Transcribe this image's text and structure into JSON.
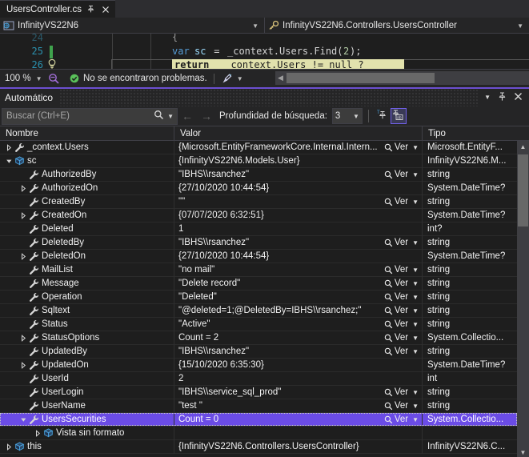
{
  "editor": {
    "tab": {
      "title": "UsersController.cs",
      "pin_icon": "pin-icon",
      "close_icon": "close-icon"
    },
    "navbar": {
      "project": "InfinityVS22N6",
      "member": "InfinityVS22N6.Controllers.UsersController"
    },
    "lines": [
      {
        "number": "24",
        "text": "{"
      },
      {
        "number": "25",
        "text": "var sc = _context.Users.Find(2);"
      },
      {
        "number": "26",
        "text": "return _context.Users != null ?"
      }
    ],
    "code": {
      "l25_kw": "var",
      "l25_var": "sc",
      "l25_eq": " = ",
      "l25_expr": "_context.Users.Find(",
      "l25_num": "2",
      "l25_end": ");",
      "l26_kw": "return",
      "l26_expr": " _context.Users != null ?"
    },
    "status": {
      "zoom": "100 %",
      "message": "No se encontraron problemas.",
      "zoom_caret_icon": "chevron-down-icon",
      "check_icon": "check-circle-icon",
      "broom_icon": "broom-icon",
      "broom_caret_icon": "chevron-down-icon"
    }
  },
  "autos": {
    "title": "Automático",
    "title_buttons": {
      "menu_icon": "chevron-down-icon",
      "pin_icon": "pin-icon",
      "close_icon": "close-icon"
    },
    "toolbar": {
      "search_placeholder": "Buscar (Ctrl+E)",
      "search_value": "",
      "search_icon": "search-icon",
      "search_caret_icon": "chevron-down-icon",
      "prev_icon": "arrow-left-icon",
      "next_icon": "arrow-right-icon",
      "depth_label": "Profundidad de búsqueda:",
      "depth_value": "3",
      "depth_caret_icon": "chevron-down-icon",
      "pin_tool_icon": "pin-variable-icon",
      "hex_tool_icon": "hex-display-icon"
    },
    "columns": [
      "Nombre",
      "Valor",
      "Tipo"
    ],
    "ver_label": "Ver",
    "ver_icon": "magnifier-icon",
    "ver_caret_icon": "chevron-down-icon",
    "rows": [
      {
        "indent": 0,
        "twisty": "collapsed",
        "icon": "wrench-icon",
        "name": "_context.Users",
        "value": "{Microsoft.EntityFrameworkCore.Internal.Intern...",
        "ver": true,
        "type": "Microsoft.EntityF...",
        "selected": false
      },
      {
        "indent": 0,
        "twisty": "expanded",
        "icon": "object-icon",
        "name": "sc",
        "value": "{InfinityVS22N6.Models.User}",
        "ver": false,
        "type": "InfinityVS22N6.M...",
        "selected": false
      },
      {
        "indent": 1,
        "twisty": "none",
        "icon": "wrench-icon",
        "name": "AuthorizedBy",
        "value": "\"IBHS\\\\rsanchez\"",
        "ver": true,
        "type": "string",
        "selected": false
      },
      {
        "indent": 1,
        "twisty": "collapsed",
        "icon": "wrench-icon",
        "name": "AuthorizedOn",
        "value": "{27/10/2020 10:44:54}",
        "ver": false,
        "type": "System.DateTime?",
        "selected": false
      },
      {
        "indent": 1,
        "twisty": "none",
        "icon": "wrench-icon",
        "name": "CreatedBy",
        "value": "\"\"",
        "ver": true,
        "type": "string",
        "selected": false
      },
      {
        "indent": 1,
        "twisty": "collapsed",
        "icon": "wrench-icon",
        "name": "CreatedOn",
        "value": "{07/07/2020 6:32:51}",
        "ver": false,
        "type": "System.DateTime?",
        "selected": false
      },
      {
        "indent": 1,
        "twisty": "none",
        "icon": "wrench-icon",
        "name": "Deleted",
        "value": "1",
        "ver": false,
        "type": "int?",
        "selected": false
      },
      {
        "indent": 1,
        "twisty": "none",
        "icon": "wrench-icon",
        "name": "DeletedBy",
        "value": "\"IBHS\\\\rsanchez\"",
        "ver": true,
        "type": "string",
        "selected": false
      },
      {
        "indent": 1,
        "twisty": "collapsed",
        "icon": "wrench-icon",
        "name": "DeletedOn",
        "value": "{27/10/2020 10:44:54}",
        "ver": false,
        "type": "System.DateTime?",
        "selected": false
      },
      {
        "indent": 1,
        "twisty": "none",
        "icon": "wrench-icon",
        "name": "MailList",
        "value": "\"no mail\"",
        "ver": true,
        "type": "string",
        "selected": false
      },
      {
        "indent": 1,
        "twisty": "none",
        "icon": "wrench-icon",
        "name": "Message",
        "value": "\"Delete record\"",
        "ver": true,
        "type": "string",
        "selected": false
      },
      {
        "indent": 1,
        "twisty": "none",
        "icon": "wrench-icon",
        "name": "Operation",
        "value": "\"Deleted\"",
        "ver": true,
        "type": "string",
        "selected": false
      },
      {
        "indent": 1,
        "twisty": "none",
        "icon": "wrench-icon",
        "name": "Sqltext",
        "value": "\"@deleted=1;@DeletedBy=IBHS\\\\rsanchez;\"",
        "ver": true,
        "type": "string",
        "selected": false
      },
      {
        "indent": 1,
        "twisty": "none",
        "icon": "wrench-icon",
        "name": "Status",
        "value": "\"Active\"",
        "ver": true,
        "type": "string",
        "selected": false
      },
      {
        "indent": 1,
        "twisty": "collapsed",
        "icon": "wrench-icon",
        "name": "StatusOptions",
        "value": "Count = 2",
        "ver": true,
        "type": "System.Collectio...",
        "selected": false
      },
      {
        "indent": 1,
        "twisty": "none",
        "icon": "wrench-icon",
        "name": "UpdatedBy",
        "value": "\"IBHS\\\\rsanchez\"",
        "ver": true,
        "type": "string",
        "selected": false
      },
      {
        "indent": 1,
        "twisty": "collapsed",
        "icon": "wrench-icon",
        "name": "UpdatedOn",
        "value": "{15/10/2020 6:35:30}",
        "ver": false,
        "type": "System.DateTime?",
        "selected": false
      },
      {
        "indent": 1,
        "twisty": "none",
        "icon": "wrench-icon",
        "name": "UserId",
        "value": "2",
        "ver": false,
        "type": "int",
        "selected": false
      },
      {
        "indent": 1,
        "twisty": "none",
        "icon": "wrench-icon",
        "name": "UserLogin",
        "value": "\"IBHS\\\\service_sql_prod\"",
        "ver": true,
        "type": "string",
        "selected": false
      },
      {
        "indent": 1,
        "twisty": "none",
        "icon": "wrench-icon",
        "name": "UserName",
        "value": "\"test \"",
        "ver": true,
        "type": "string",
        "selected": false
      },
      {
        "indent": 1,
        "twisty": "expanded",
        "icon": "wrench-icon",
        "name": "UsersSecurities",
        "value": "Count = 0",
        "ver": true,
        "type": "System.Collectio...",
        "selected": true
      },
      {
        "indent": 2,
        "twisty": "collapsed",
        "icon": "object-icon",
        "name": "Vista sin formato",
        "value": "",
        "ver": false,
        "type": "",
        "selected": false
      },
      {
        "indent": 0,
        "twisty": "collapsed",
        "icon": "object-icon",
        "name": "this",
        "value": "{InfinityVS22N6.Controllers.UsersController}",
        "ver": false,
        "type": "InfinityVS22N6.C...",
        "selected": false
      }
    ],
    "scrollbar": {
      "up_icon": "chevron-up-icon",
      "down_icon": "chevron-down-icon"
    }
  },
  "colors": {
    "accent": "#6b4ce6",
    "panel_bg": "#252526",
    "grid_bg": "#1e1e1e",
    "highlight": "#e2e2ad",
    "keyword": "#569cd6",
    "control_keyword": "#c586c0",
    "linenum": "#2b91af"
  }
}
